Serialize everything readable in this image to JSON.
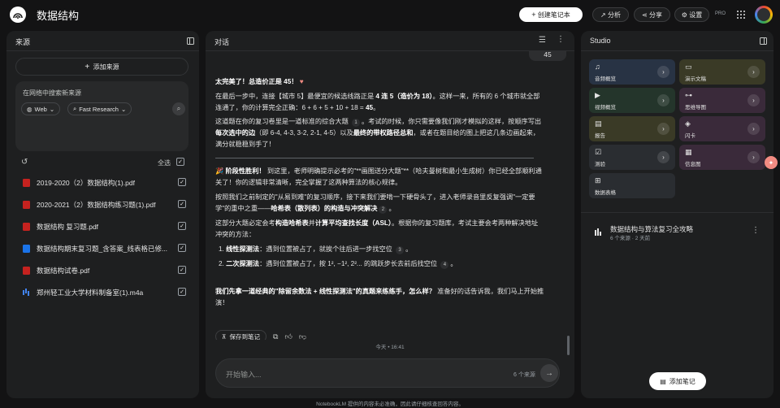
{
  "app": {
    "title": "数据结构",
    "create_notebook": "创建笔记本",
    "analytics": "分析",
    "share": "分享",
    "settings": "设置",
    "pro_badge": "PRO"
  },
  "sources": {
    "header": "来源",
    "add_source": "添加来源",
    "search_label": "在网络中搜索新来源",
    "web_chip": "Web",
    "research_chip": "Fast Research",
    "select_all": "全选",
    "items": [
      {
        "name": "2019-2020（2）数据结构(1).pdf",
        "type": "pdf",
        "checked": true
      },
      {
        "name": "2020-2021（2）数据结构练习题(1).pdf",
        "type": "pdf",
        "checked": true
      },
      {
        "name": "数据结构 复习题.pdf",
        "type": "pdf",
        "checked": true
      },
      {
        "name": "数据结构期末复习题_含答案_线表格已修...",
        "type": "doc",
        "checked": true
      },
      {
        "name": "数据结构试卷.pdf",
        "type": "pdf",
        "checked": true
      },
      {
        "name": "郑州轻工业大学材料制备室(1).m4a",
        "type": "audio",
        "checked": true
      }
    ]
  },
  "chat": {
    "header": "对话",
    "user_last": "45",
    "p1": "太完美了！总造价正是 45！",
    "p2a": "在最后一步中，连接【城市 5】最便宜的候选线路正是 ",
    "p2b": "4 连 5（造价为 18）",
    "p2c": "。这样一来，所有的 6 个城市就全部连通了，你的计算完全正确：6 + 6 + 5 + 10 + 18 = ",
    "p2d": "45",
    "p3a": "这道题在你的复习卷里是一道标准的综合大题 ",
    "p3cite": "1",
    "p3b": "。考试的时候，你只需要像我们刚才模拟的这样，按顺序写出",
    "p3c": "每次选中的边",
    "p3d": "（即 6-4, 4-3, 3-2, 2-1, 4-5）以及",
    "p3e": "最终的带权路径总和",
    "p3f": "，或者在题目给的图上把这几条边画起来，满分就稳稳到手了！",
    "p4a": "阶段性胜利！",
    "p4b": " 到这里，老师明确提示必考的\"**画图送分大题\"**（哈夫曼树和最小生成树）你已经全部顺利通关了！你的逻辑非常清晰，完全掌握了这两种算法的核心规律。",
    "p5a": "按照我们之前制定的\"从易到难\"的复习顺序，接下来我们要啃一下硬骨头了，进入老师录音里反复强调\"一定要学\"的重中之重——",
    "p5b": "哈希表（散列表）的构造与冲突解决",
    "p5cite": "2",
    "p6a": "这部分大题必定会考",
    "p6b": "构造哈希表",
    "p6c": "并",
    "p6d": "计算平均查找长度（ASL）",
    "p6e": "。根据你的复习题库，考试主要会考两种解决地址冲突的方法：",
    "li1a": "1. ",
    "li1b": "线性探测法",
    "li1c": "：遇到位置被占了，就挨个往后进一步找空位 ",
    "li1cite": "3",
    "li2a": "2. ",
    "li2b": "二次探测法",
    "li2c": "：遇到位置被占了，按 1², −1², 2²... 的跳跃步长去前后找空位 ",
    "li2cite": "4",
    "p7a": "我们先拿一道经典的\"除留余数法 + 线性探测法\"的真题来练练手，怎么样？",
    "p7b": " 准备好的话告诉我，我们马上开始推演！",
    "save_to_note": "保存到笔记",
    "timestamp": "今天 • 16:41",
    "input_placeholder": "开始输入...",
    "source_count": "6 个来源"
  },
  "studio": {
    "header": "Studio",
    "tiles": [
      {
        "label": "音频概览",
        "icon": "audio-icon",
        "glyph": "♫",
        "color": "blue"
      },
      {
        "label": "演示文稿",
        "icon": "slides-icon",
        "glyph": "▭",
        "color": "olive"
      },
      {
        "label": "视频概览",
        "icon": "video-icon",
        "glyph": "▶",
        "color": "green"
      },
      {
        "label": "思维导图",
        "icon": "mindmap-icon",
        "glyph": "⊶",
        "color": "purple"
      },
      {
        "label": "报告",
        "icon": "report-icon",
        "glyph": "▤",
        "color": "olive"
      },
      {
        "label": "闪卡",
        "icon": "flashcard-icon",
        "glyph": "◈",
        "color": "purple"
      },
      {
        "label": "测验",
        "icon": "quiz-icon",
        "glyph": "☑",
        "color": "slate"
      },
      {
        "label": "信息图",
        "icon": "infographic-icon",
        "glyph": "▦",
        "color": "purple"
      },
      {
        "label": "数据表格",
        "icon": "table-icon",
        "glyph": "⊞",
        "color": "slate"
      }
    ],
    "note_title": "数据结构与算法复习全攻略",
    "note_meta": "6 个来源 · 2 天前",
    "add_note": "添加笔记"
  },
  "footer": "NotebookLM 提供的内容未必准确，因此请仔细核查回答内容。"
}
